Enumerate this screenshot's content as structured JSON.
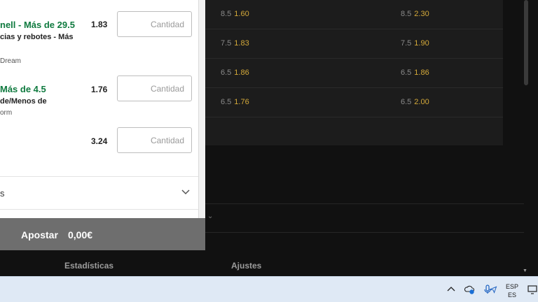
{
  "odds_table": {
    "rows": [
      {
        "a_line": "8.5",
        "a_price": "1.60",
        "b_line": "8.5",
        "b_price": "2.30"
      },
      {
        "a_line": "7.5",
        "a_price": "1.83",
        "b_line": "7.5",
        "b_price": "1.90"
      },
      {
        "a_line": "6.5",
        "a_price": "1.86",
        "b_line": "6.5",
        "b_price": "1.86"
      },
      {
        "a_line": "6.5",
        "a_price": "1.76",
        "b_line": "6.5",
        "b_price": "2.00"
      }
    ]
  },
  "betslip": {
    "selections": [
      {
        "title": "nell - Más de 29.5",
        "subtitle": "cias y rebotes - Más",
        "meta": "Dream",
        "odds": "1.83",
        "stake_placeholder": "Cantidad"
      },
      {
        "title": "Más de 4.5",
        "subtitle": "de/Menos de",
        "meta": "orm",
        "odds": "1.76",
        "stake_placeholder": "Cantidad"
      },
      {
        "odds": "3.24",
        "stake_placeholder": "Cantidad"
      }
    ],
    "options_label": "s",
    "place_bet": {
      "label": "Apostar",
      "amount": "0,00€"
    }
  },
  "bottom_tabs": {
    "stats": "Estadísticas",
    "settings": "Ajustes"
  },
  "taskbar": {
    "lang_top": "ESP",
    "lang_bottom": "ES"
  },
  "colors": {
    "accent_green": "#0f7a3f",
    "odds_gold": "#d4a93a",
    "button_grey": "#6e6e6e"
  },
  "icons": [
    "chevron-up-icon",
    "cloud-info-icon",
    "microphone-icon",
    "send-icon",
    "monitor-icon",
    "chevron-down-icon"
  ]
}
